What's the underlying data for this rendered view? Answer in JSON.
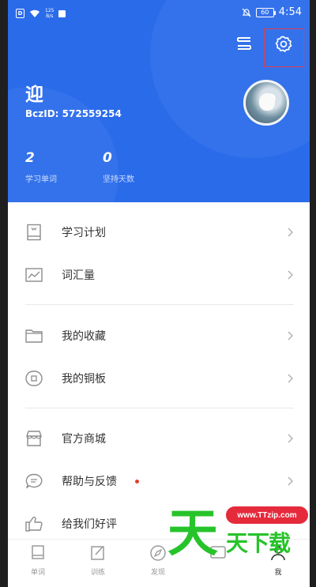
{
  "status_bar": {
    "sim_label": "D",
    "speed_value": "125",
    "speed_unit": "B/s",
    "battery": "60",
    "time": "4:54"
  },
  "header": {
    "username": "迎",
    "bcz_id": "BczID: 572559254",
    "stats": [
      {
        "value": "2",
        "label": "学习单词"
      },
      {
        "value": "0",
        "label": "坚持天数"
      }
    ],
    "switch_icon": "swap-icon",
    "settings_icon": "gear-icon",
    "accent": "#2a6bea",
    "highlight_color": "#e43d4b"
  },
  "menu": {
    "group1": [
      {
        "label": "学习计划",
        "icon": "book-plan-icon"
      },
      {
        "label": "词汇量",
        "icon": "trend-chart-icon"
      }
    ],
    "group2": [
      {
        "label": "我的收藏",
        "icon": "folder-icon"
      },
      {
        "label": "我的铜板",
        "icon": "coin-icon"
      }
    ],
    "group3": [
      {
        "label": "官方商城",
        "icon": "store-icon"
      },
      {
        "label": "帮助与反馈",
        "icon": "chat-bubble-icon"
      },
      {
        "label": "给我们好评",
        "icon": "thumbs-up-icon"
      }
    ]
  },
  "tab_bar": {
    "tabs": [
      {
        "label": "单词",
        "icon": "book-icon"
      },
      {
        "label": "训练",
        "icon": "edit-icon"
      },
      {
        "label": "发现",
        "icon": "compass-icon"
      },
      {
        "label": "",
        "icon": "message-icon"
      },
      {
        "label": "我",
        "icon": "person-icon"
      }
    ],
    "active_index": 4
  },
  "watermark": {
    "big_char": "天",
    "small_text": "天下载",
    "url": "www.TTzip.com",
    "green": "#27c32a",
    "red": "#e52a3b"
  }
}
